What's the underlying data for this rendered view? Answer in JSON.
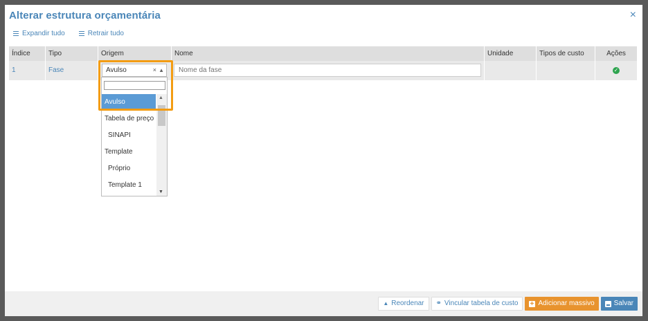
{
  "modal": {
    "title": "Alterar estrutura orçamentária",
    "close_icon": "×"
  },
  "toolbar": {
    "expand_label": "Expandir tudo",
    "collapse_label": "Retrair tudo"
  },
  "table": {
    "headers": [
      "Índice",
      "Tipo",
      "Origem",
      "Nome",
      "Unidade",
      "Tipos de custo",
      "Ações"
    ],
    "row": {
      "index": "1",
      "type": "Fase",
      "origin": "Avulso",
      "name_placeholder": "Nome da fase",
      "unit": "",
      "cost_types": "",
      "status_icon": "check-circle-icon"
    }
  },
  "origin_select": {
    "value": "Avulso",
    "clear_icon": "×",
    "caret_icon": "▲",
    "options": [
      {
        "label": "Avulso",
        "selected": true,
        "child": false
      },
      {
        "label": "Tabela de preço",
        "selected": false,
        "child": false
      },
      {
        "label": "SINAPI",
        "selected": false,
        "child": true
      },
      {
        "label": "Template",
        "selected": false,
        "child": false
      },
      {
        "label": "Próprio",
        "selected": false,
        "child": true
      },
      {
        "label": "Template 1",
        "selected": false,
        "child": true
      }
    ]
  },
  "footer": {
    "reorder_label": "Reordenar",
    "link_table_label": "Vincular tabela de custo",
    "bulk_add_label": "Adicionar massivo",
    "save_label": "Salvar"
  },
  "colors": {
    "accent": "#4a86b8",
    "highlight": "#f39c12",
    "orange_button": "#e8932e",
    "selected_option": "#5b9bd5",
    "success": "#2ea44f"
  }
}
